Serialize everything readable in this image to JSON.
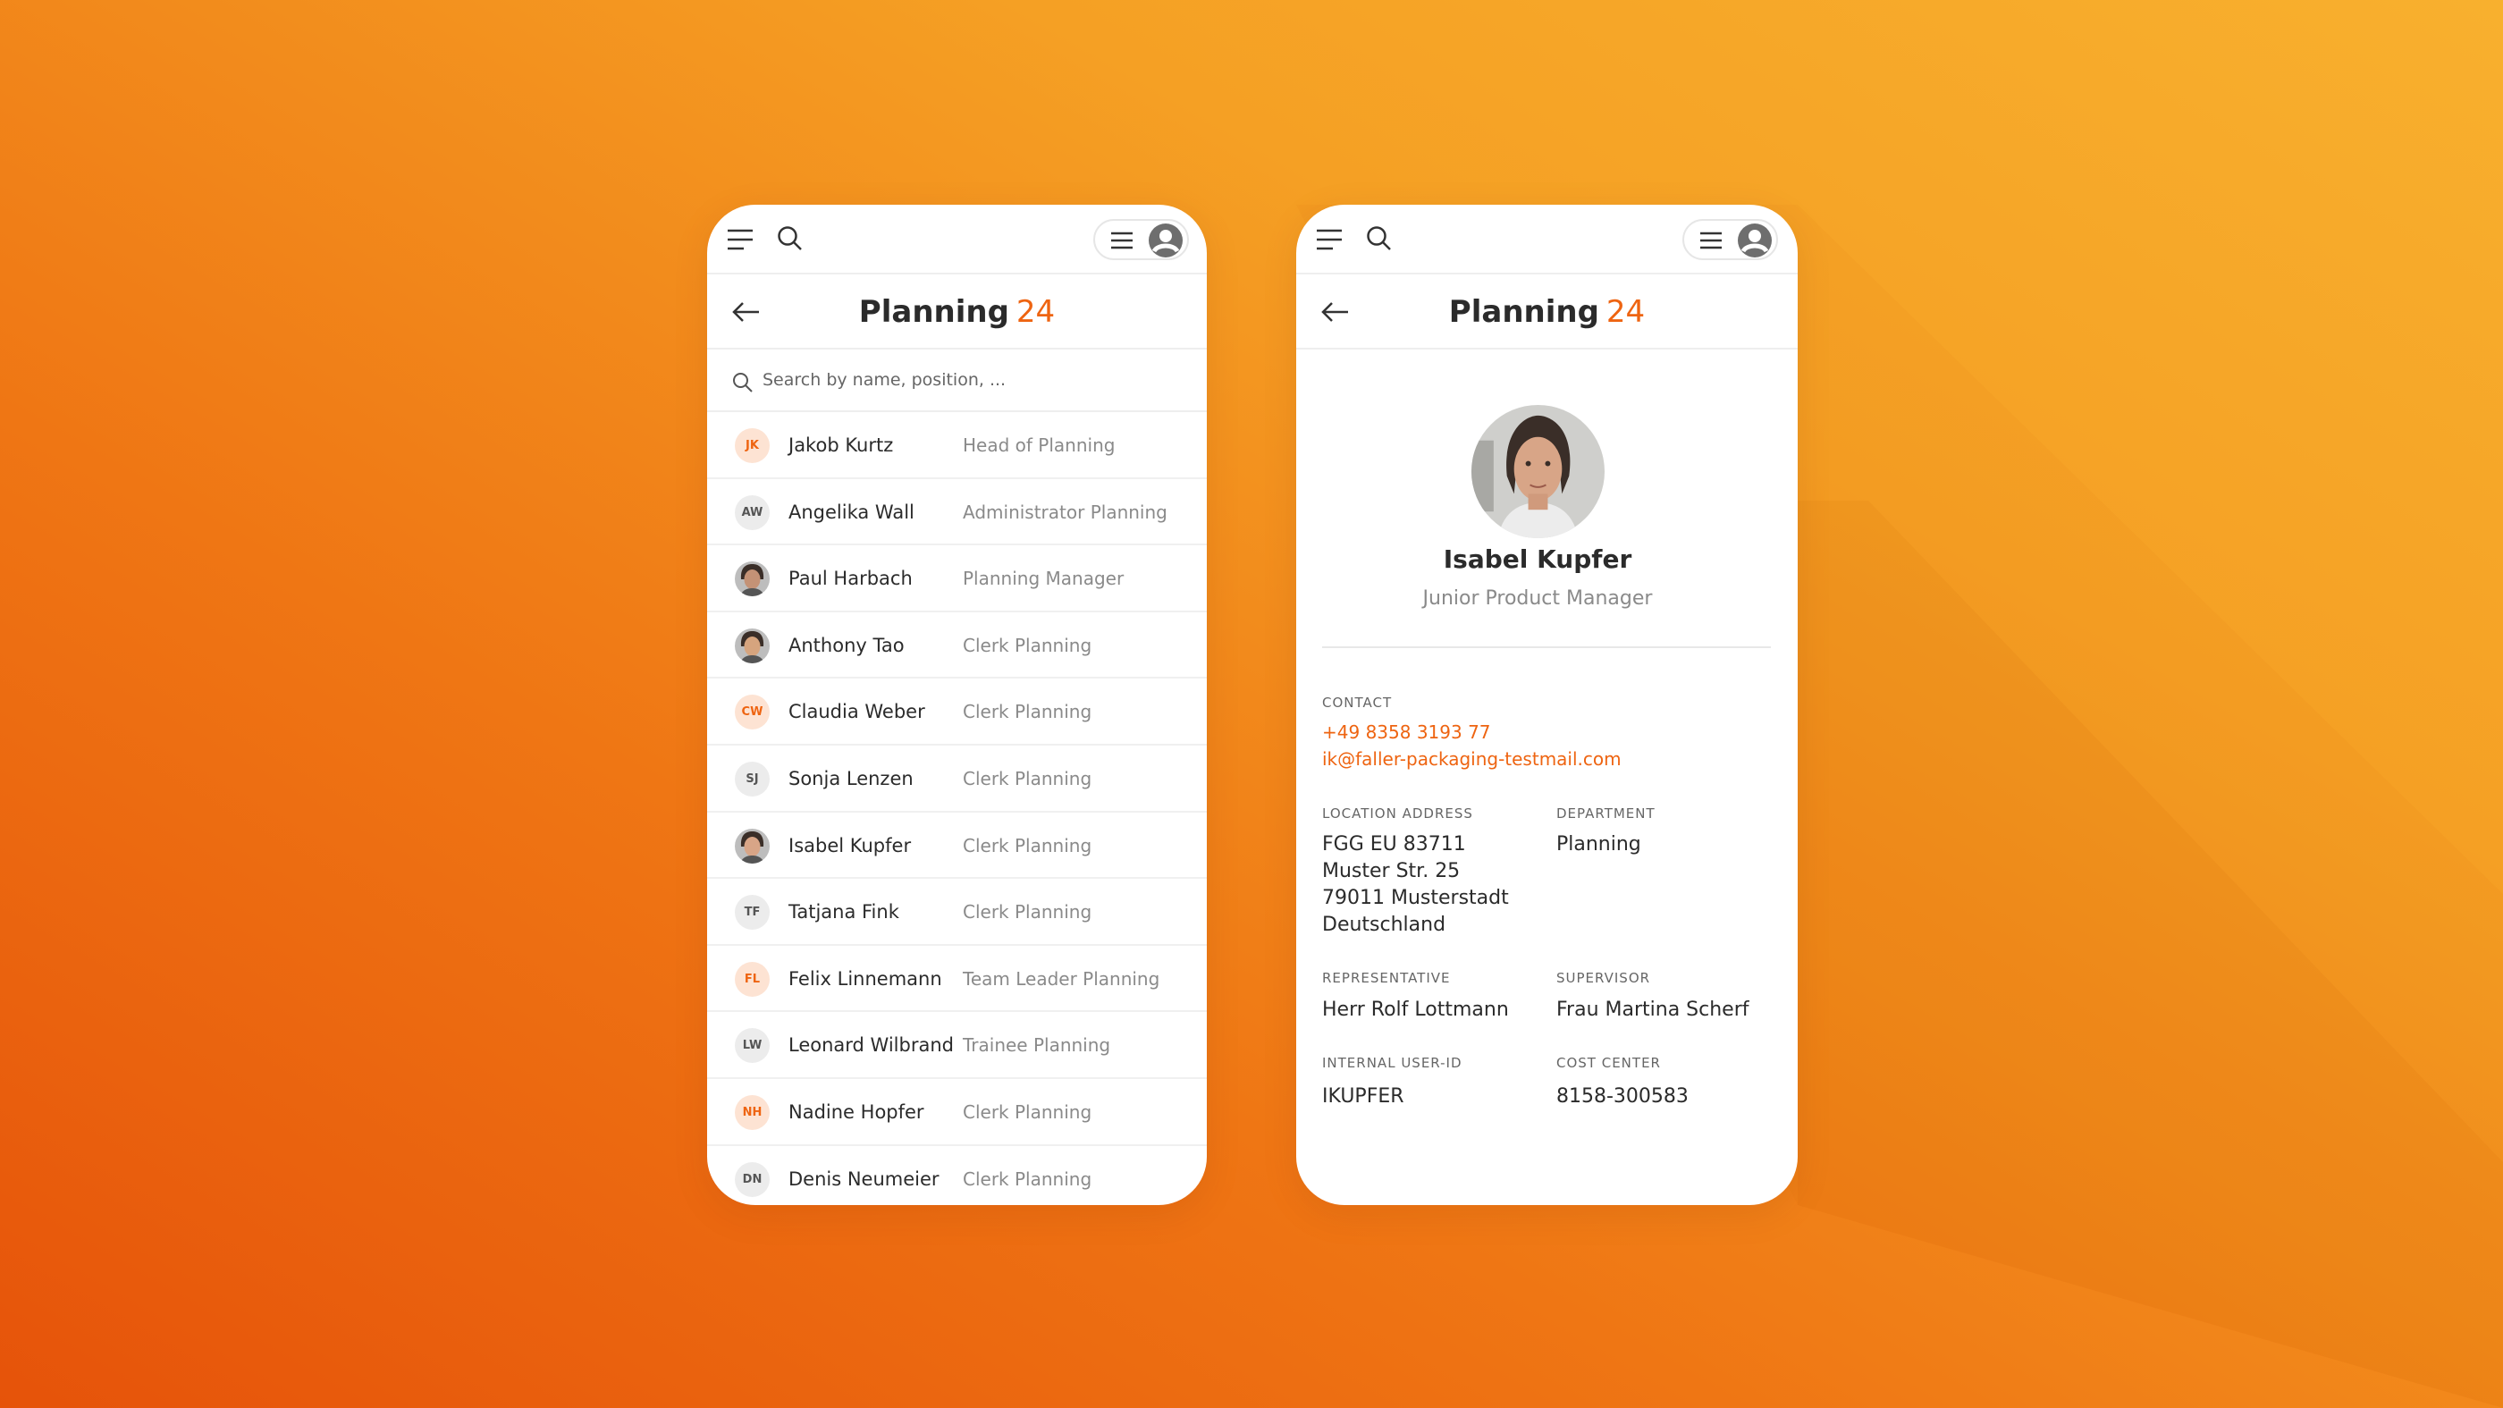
{
  "colors": {
    "accent": "#ee6411",
    "initials_orange_bg": "#fde3d3",
    "initials_gray_bg": "#ececec"
  },
  "icons": {
    "menu": "menu-icon",
    "search": "search-icon",
    "list": "list-icon",
    "account": "user-account-icon",
    "back": "arrow-left-icon"
  },
  "list_screen": {
    "title": "Planning",
    "count": "24",
    "search_placeholder": "Search by name, position, ...",
    "people": [
      {
        "initials": "JK",
        "name": "Jakob Kurtz",
        "position": "Head of Planning",
        "avatar": "initials",
        "tone": "orange"
      },
      {
        "initials": "AW",
        "name": "Angelika Wall",
        "position": "Administrator Planning",
        "avatar": "initials",
        "tone": "gray"
      },
      {
        "initials": "",
        "name": "Paul Harbach",
        "position": "Planning Manager",
        "avatar": "photo",
        "tone": "photo"
      },
      {
        "initials": "",
        "name": "Anthony Tao",
        "position": "Clerk Planning",
        "avatar": "photo",
        "tone": "photo"
      },
      {
        "initials": "CW",
        "name": "Claudia Weber",
        "position": "Clerk Planning",
        "avatar": "initials",
        "tone": "orange"
      },
      {
        "initials": "SJ",
        "name": "Sonja Lenzen",
        "position": "Clerk Planning",
        "avatar": "initials",
        "tone": "gray"
      },
      {
        "initials": "",
        "name": "Isabel Kupfer",
        "position": "Clerk Planning",
        "avatar": "photo",
        "tone": "photo"
      },
      {
        "initials": "TF",
        "name": "Tatjana Fink",
        "position": "Clerk Planning",
        "avatar": "initials",
        "tone": "gray"
      },
      {
        "initials": "FL",
        "name": "Felix Linnemann",
        "position": "Team Leader Planning",
        "avatar": "initials",
        "tone": "orange"
      },
      {
        "initials": "LW",
        "name": "Leonard Wilbrand",
        "position": "Trainee Planning",
        "avatar": "initials",
        "tone": "gray"
      },
      {
        "initials": "NH",
        "name": "Nadine Hopfer",
        "position": "Clerk Planning",
        "avatar": "initials",
        "tone": "orange"
      },
      {
        "initials": "DN",
        "name": "Denis Neumeier",
        "position": "Clerk Planning",
        "avatar": "initials",
        "tone": "gray"
      }
    ]
  },
  "detail_screen": {
    "title": "Planning",
    "count": "24",
    "name": "Isabel Kupfer",
    "role": "Junior Product Manager",
    "contact_label": "CONTACT",
    "phone": "+49 8358 3193 77",
    "email": "ik@faller-packaging-testmail.com",
    "location_label": "LOCATION ADDRESS",
    "location_lines": [
      "FGG EU 83711",
      "Muster Str. 25",
      "79011 Musterstadt",
      "Deutschland"
    ],
    "department_label": "DEPARTMENT",
    "department": "Planning",
    "representative_label": "REPRESENTATIVE",
    "representative": "Herr Rolf Lottmann",
    "supervisor_label": "SUPERVISOR",
    "supervisor": "Frau Martina Scherf",
    "user_id_label": "INTERNAL USER-ID",
    "user_id": "IKUPFER",
    "cost_center_label": "COST CENTER",
    "cost_center": "8158-300583"
  }
}
